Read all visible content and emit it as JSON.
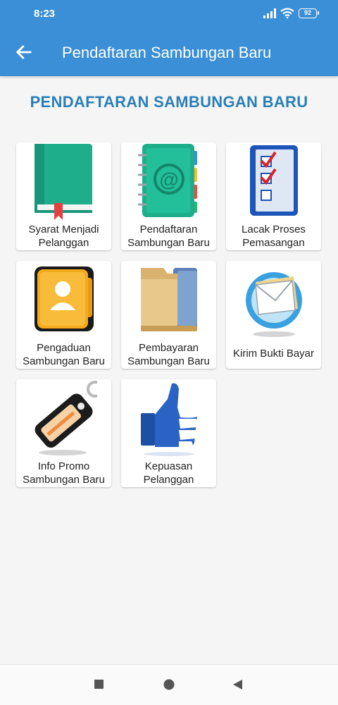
{
  "status_bar": {
    "time": "8:23",
    "battery": "92",
    "icons": [
      "signal-icon",
      "wifi-icon",
      "battery-icon"
    ]
  },
  "app_bar": {
    "title": "Pendaftaran Sambungan Baru",
    "back_icon": "arrow-left-icon",
    "color": "#3b8fd6"
  },
  "heading": "PENDAFTARAN SAMBUNGAN BARU",
  "menu": {
    "items": [
      {
        "label": "Syarat Menjadi Pelanggan",
        "icon": "green-book-icon"
      },
      {
        "label": "Pendaftaran Sambungan Baru",
        "icon": "address-book-icon"
      },
      {
        "label": "Lacak Proses Pemasangan",
        "icon": "checklist-icon"
      },
      {
        "label": "Pengaduan Sambungan Baru",
        "icon": "contact-folder-icon"
      },
      {
        "label": "Pembayaran Sambungan Baru",
        "icon": "file-folder-icon"
      },
      {
        "label": "Kirim Bukti Bayar",
        "icon": "mail-globe-icon"
      },
      {
        "label": "Info Promo Sambungan Baru",
        "icon": "price-tag-icon"
      },
      {
        "label": "Kepuasan Pelanggan",
        "icon": "thumbs-up-icon"
      }
    ]
  },
  "nav_bar": {
    "buttons": [
      "recent-apps-icon",
      "home-icon",
      "back-triangle-icon"
    ]
  }
}
